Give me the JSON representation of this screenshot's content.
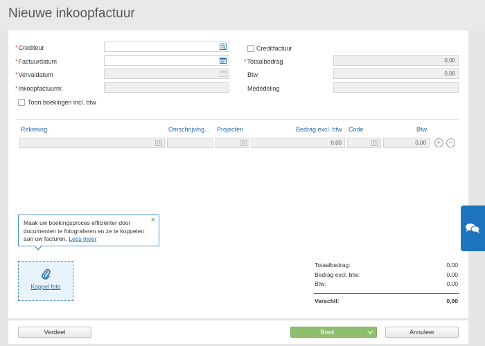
{
  "title": "Nieuwe inkoopfactuur",
  "form": {
    "crediteur_label": "Crediteur",
    "factuurdatum_label": "Factuurdatum",
    "vervaldatum_label": "Vervaldatum",
    "inkoopfactuurnr_label": "Inkoopfactuurnr.",
    "toon_boekingen_label": "Toon boekingen incl. btw",
    "creditfactuur_label": "Creditfactuur",
    "totaalbedrag_label": "Totaalbedrag",
    "totaalbedrag_value": "0,00",
    "btw_label": "Btw",
    "btw_value": "0,00",
    "mededeling_label": "Mededeling"
  },
  "lines": {
    "headers": {
      "rekening": "Rekening",
      "omschrijving": "Omschrijving...",
      "projecten": "Projecten",
      "bedrag": "Bedrag excl. btw",
      "code": "Code",
      "btw": "Btw"
    },
    "row": {
      "bedrag": "0,00",
      "btw": "0,00"
    },
    "add_symbol": "+",
    "remove_symbol": "−"
  },
  "tooltip": {
    "text": "Maak uw boekingsproces efficiënter door documenten te fotograferen en ze te koppelen aan uw facturen.",
    "link": "Lees meer",
    "close": "×"
  },
  "photo": {
    "label": "Koppel foto"
  },
  "totals": {
    "totaalbedrag_label": "Totaalbedrag:",
    "totaalbedrag_value": "0,00",
    "bedrag_excl_label": "Bedrag excl. btw:",
    "bedrag_excl_value": "0,00",
    "btw_label": "Btw:",
    "btw_value": "0,00",
    "verschil_label": "Verschil:",
    "verschil_value": "0,00"
  },
  "footer": {
    "verdeel": "Verdeel",
    "boek": "Boek",
    "annuleer": "Annuleer"
  },
  "required_marker": "*",
  "colors": {
    "accent": "#1e73be",
    "link": "#2a6ba8",
    "required": "#dd3333",
    "boek": "#8fbf6e"
  },
  "icons": [
    "search-lookup-icon",
    "calendar-icon",
    "lookup-icon",
    "paperclip-icon",
    "chat-icon",
    "chevron-down-icon"
  ]
}
